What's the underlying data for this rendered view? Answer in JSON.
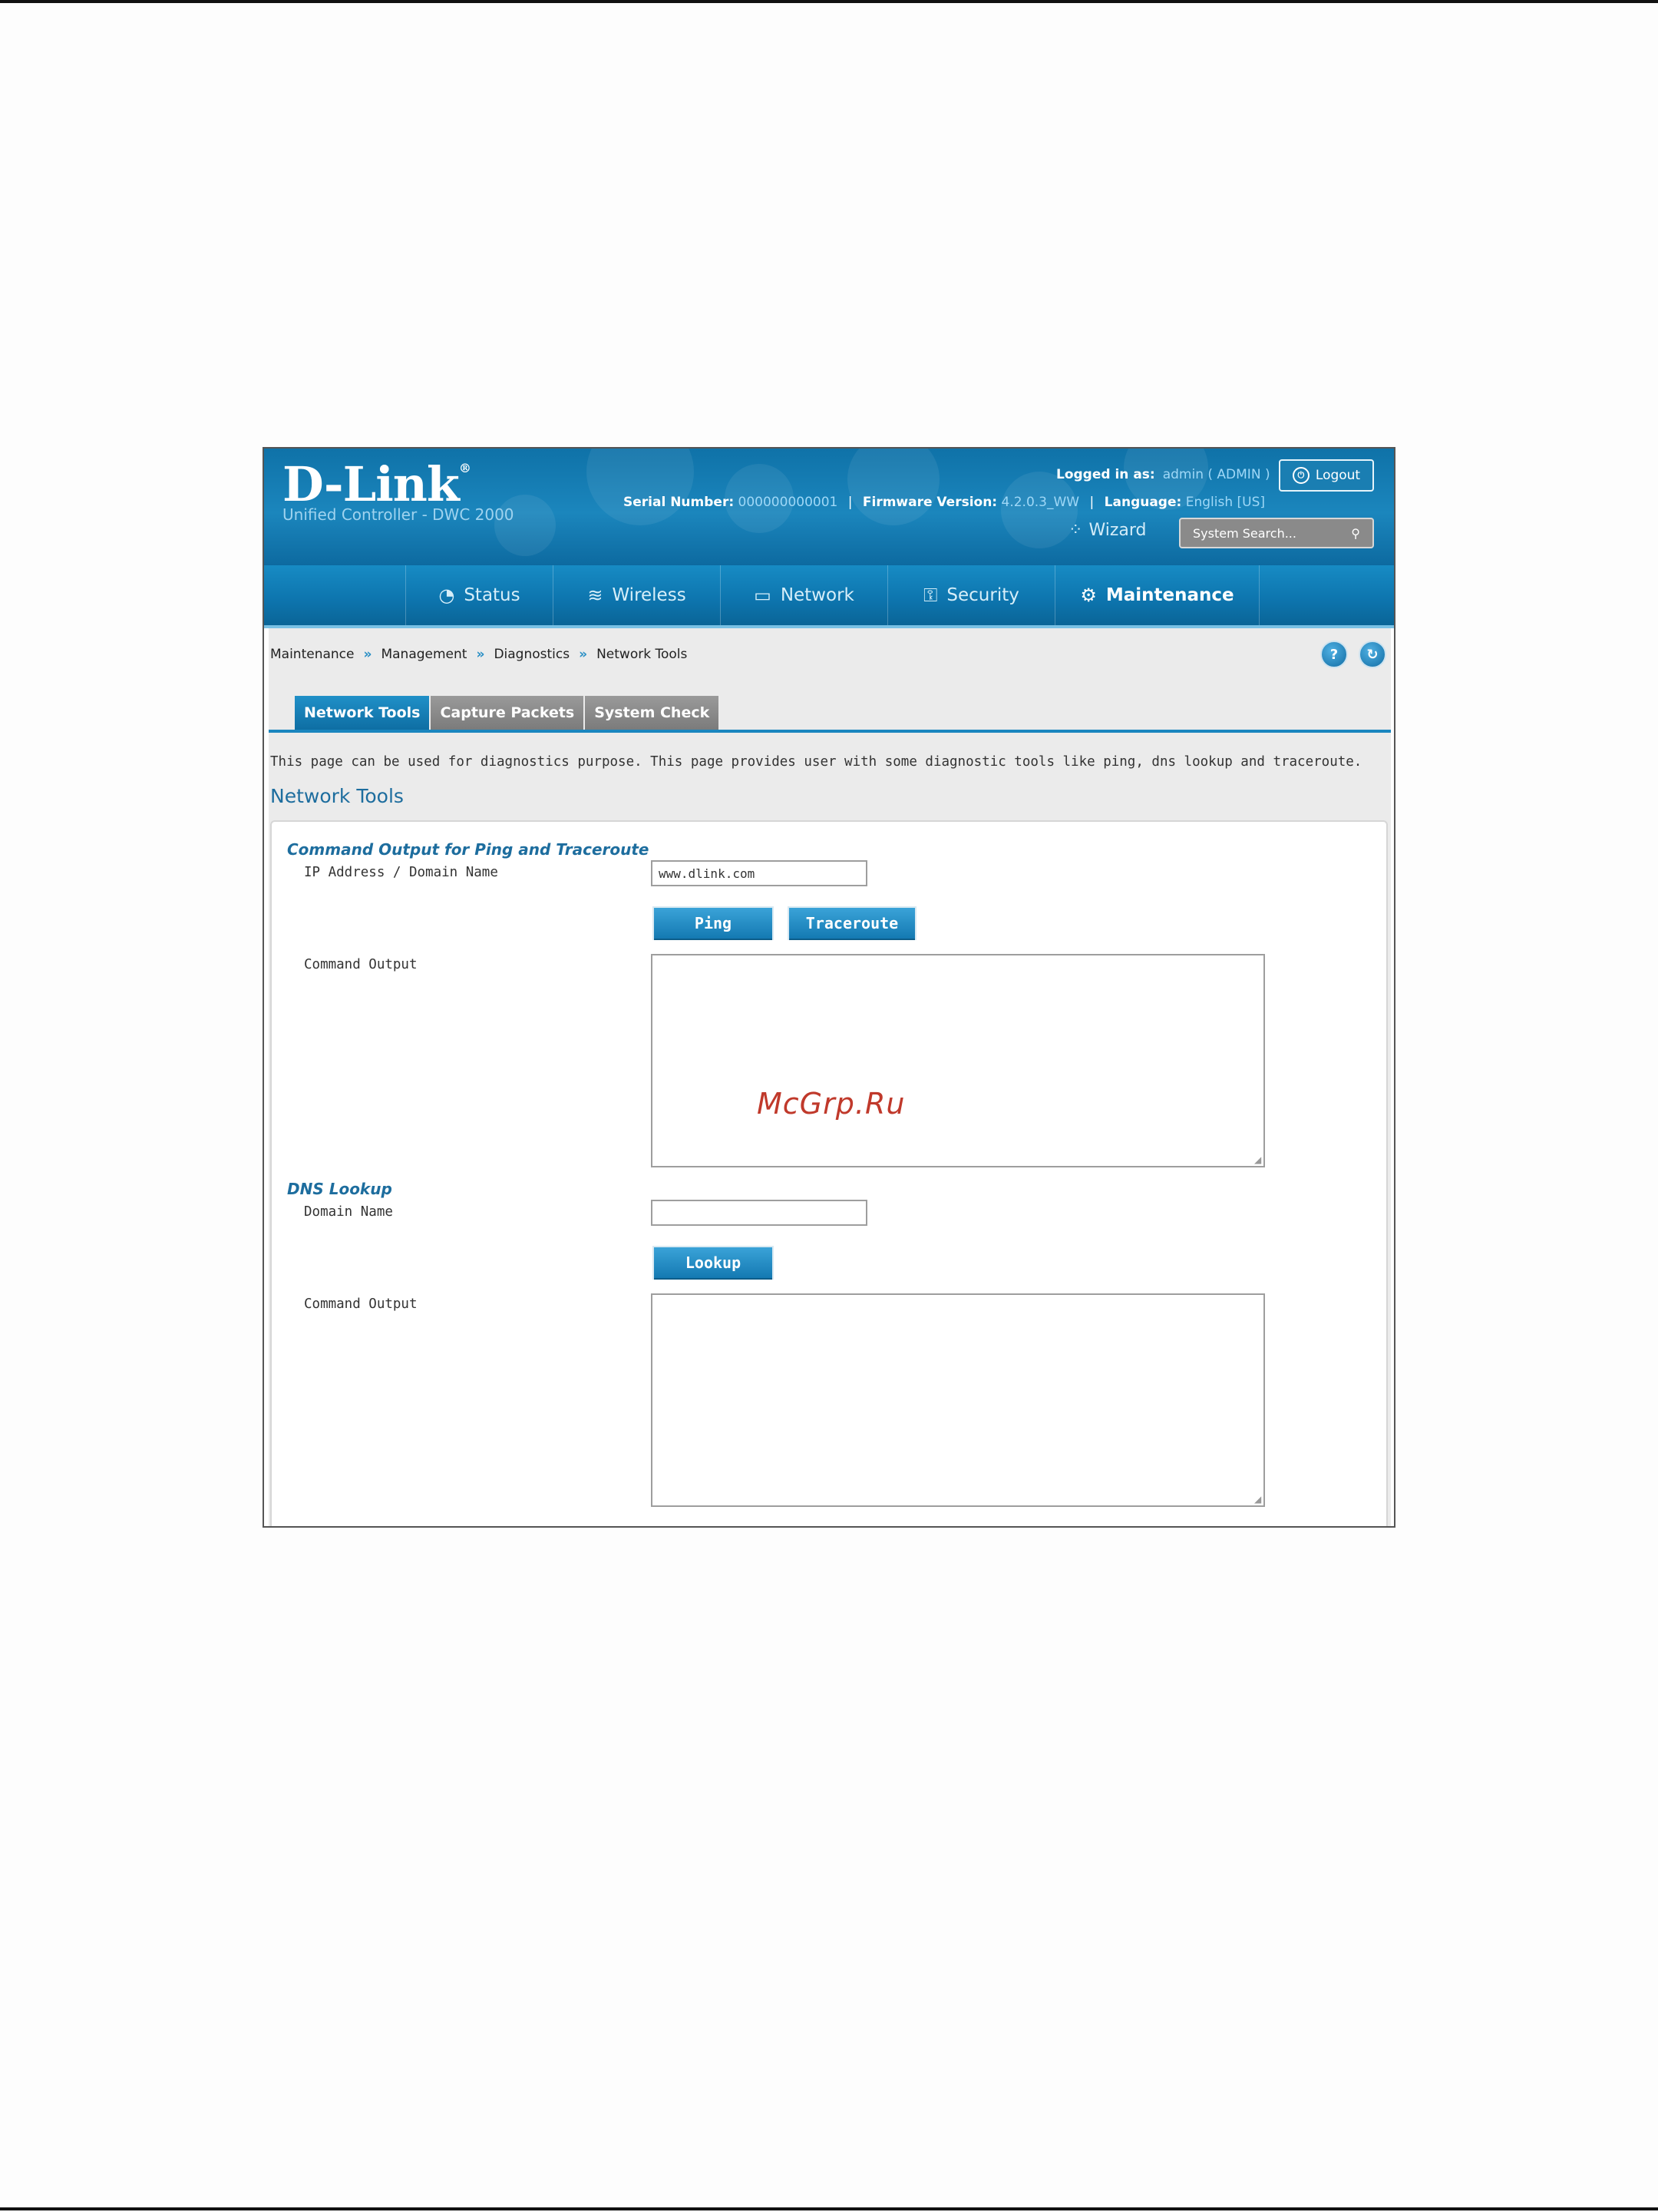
{
  "header": {
    "brand": "D-Link",
    "brand_mark": "®",
    "product": "Unified Controller - DWC 2000",
    "logged_in_label": "Logged in as:",
    "logged_in_user": "admin ( ADMIN )",
    "logout_label": "Logout",
    "serial_label": "Serial Number:",
    "serial_value": "000000000001",
    "firmware_label": "Firmware Version:",
    "firmware_value": "4.2.0.3_WW",
    "language_label": "Language:",
    "language_value": "English [US]",
    "wizard_label": "Wizard",
    "search_placeholder": "System Search..."
  },
  "nav": {
    "items": [
      {
        "label": "Status",
        "icon": "gauge-icon"
      },
      {
        "label": "Wireless",
        "icon": "wifi-icon"
      },
      {
        "label": "Network",
        "icon": "monitor-icon"
      },
      {
        "label": "Security",
        "icon": "lock-icon"
      },
      {
        "label": "Maintenance",
        "icon": "gear-icon"
      }
    ],
    "active": "Maintenance"
  },
  "breadcrumb": [
    "Maintenance",
    "Management",
    "Diagnostics",
    "Network Tools"
  ],
  "tabs": [
    {
      "label": "Network Tools",
      "active": true
    },
    {
      "label": "Capture Packets",
      "active": false
    },
    {
      "label": "System Check",
      "active": false
    }
  ],
  "intro": "This page can be used for diagnostics purpose. This page provides user with some diagnostic tools like ping, dns lookup and traceroute.",
  "section_title": "Network Tools",
  "ping_section": {
    "legend": "Command Output for Ping and Traceroute",
    "address_label": "IP Address / Domain Name",
    "address_value": "www.dlink.com",
    "ping_button": "Ping",
    "traceroute_button": "Traceroute",
    "output_label": "Command Output",
    "output_value": ""
  },
  "dns_section": {
    "legend": "DNS Lookup",
    "domain_label": "Domain Name",
    "domain_value": "",
    "lookup_button": "Lookup",
    "output_label": "Command Output",
    "output_value": ""
  },
  "watermark": "McGrp.Ru",
  "colors": {
    "header_blue": "#1b86bd",
    "accent_blue": "#1479b2",
    "tab_inactive": "#7b7b7b",
    "watermark_red": "#c0392b"
  }
}
